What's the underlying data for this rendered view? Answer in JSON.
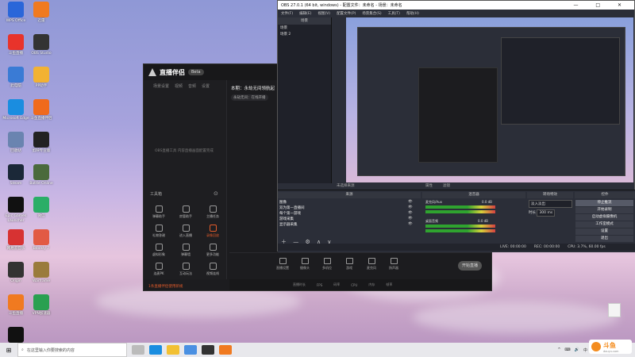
{
  "desktop": {
    "icons": [
      {
        "label": "WPS Office",
        "color": "#2a66d9"
      },
      {
        "label": "迅雷",
        "color": "#f07a20"
      },
      {
        "label": "斗鱼直播",
        "color": "#e8332b"
      },
      {
        "label": "OBS Studio",
        "color": "#333"
      },
      {
        "label": "此电脑",
        "color": "#3a7bd5"
      },
      {
        "label": "PP助手",
        "color": "#f2b233"
      },
      {
        "label": "Microsoft Edge",
        "color": "#1a8de0"
      },
      {
        "label": "斗鱼直播伴侣",
        "color": "#f06a1c"
      },
      {
        "label": "回收站",
        "color": "#6a84b0"
      },
      {
        "label": "剪映专业版",
        "color": "#222"
      },
      {
        "label": "Steam",
        "color": "#1b2838"
      },
      {
        "label": "Battle Online",
        "color": "#4a6a3c"
      },
      {
        "label": "Epic Games Launcher",
        "color": "#111"
      },
      {
        "label": "微信",
        "color": "#2aae67"
      },
      {
        "label": "网易云音乐",
        "color": "#d73232"
      },
      {
        "label": "Blockly 7",
        "color": "#e25a44"
      },
      {
        "label": "Origin",
        "color": "#333"
      },
      {
        "label": "Warframe",
        "color": "#9a7b3c"
      },
      {
        "label": "斗鱼直播",
        "color": "#f07a20"
      },
      {
        "label": "VPN加速器",
        "color": "#2aa050"
      },
      {
        "label": "Logitech G HUB",
        "color": "#111"
      }
    ]
  },
  "live": {
    "logo": "直播伴侣",
    "version": "Beta",
    "tabs": [
      "场景设置",
      "视频",
      "音频",
      "设置"
    ],
    "tip": "OBS直播工具 内容直播画面配置完成",
    "tools_label": "工具箱",
    "tools": [
      "弹幕助手",
      "房管助手",
      "主播任务",
      "礼物答谢",
      "进入直播",
      "录像回放",
      "虚拟形象",
      "弹幕墙",
      "更多功能",
      "连麦PK",
      "互动玩法",
      "视频连线"
    ],
    "room_title": "本期：永劫无间领航起",
    "category": "永劫无间：在线开播",
    "pill_top": "开播",
    "pill_bottom": "开播",
    "hint": "鼠标右键点击可切换",
    "bottom_buttons": [
      "直播设置",
      "摄像头",
      "多机位",
      "游戏",
      "麦克风",
      "扬声器"
    ],
    "start_label": "开始直播",
    "notice": "1条直播伴侣使用新规",
    "notice_link": "直播伴侣使用新规",
    "status": [
      "直播时长",
      "FPS",
      "码率",
      "CPU",
      "内存",
      "帧率"
    ]
  },
  "obs": {
    "title": "OBS 27.0.1 (64 bit, windows) - 配置文件：未命名 - 场景：未命名",
    "menus": [
      "文件(F)",
      "编辑(E)",
      "视图(V)",
      "配置文件(P)",
      "场景集合(S)",
      "工具(T)",
      "帮助(H)"
    ],
    "scenes_header": "场景",
    "scenes": [
      "场景",
      "场景 2"
    ],
    "sources_header": "来源",
    "source_label": "未选择来源",
    "props": "属性",
    "filters": "滤镜",
    "sources": [
      "图像",
      "双为第一直播间",
      "每个第一游戏",
      "游戏采集",
      "显示器采集"
    ],
    "mixer_header": "混音器",
    "mixer": [
      {
        "name": "麦克风/Aux",
        "db": "0.0 dB"
      },
      {
        "name": "桌面音频",
        "db": "0.0 dB"
      }
    ],
    "trans_header": "转场特效",
    "transition": "淡入淡出",
    "duration_label": "时长",
    "duration": "300 ms",
    "controls_header": "控件",
    "controls": [
      "停止推流",
      "开始录制",
      "启动虚拟摄像机",
      "工作室模式",
      "设置",
      "退出"
    ],
    "status": [
      "LIVE: 00:00:00",
      "REC: 00:00:00",
      "CPU: 3.7%, 60.00 fps"
    ]
  },
  "taskbar": {
    "search_placeholder": "在这里输入你要搜索的内容",
    "tray_lang": "中",
    "tray_icons": [
      "^",
      "⌨",
      "🔊"
    ]
  },
  "watermark": {
    "text": "斗鱼",
    "sub": "douyu.com"
  }
}
